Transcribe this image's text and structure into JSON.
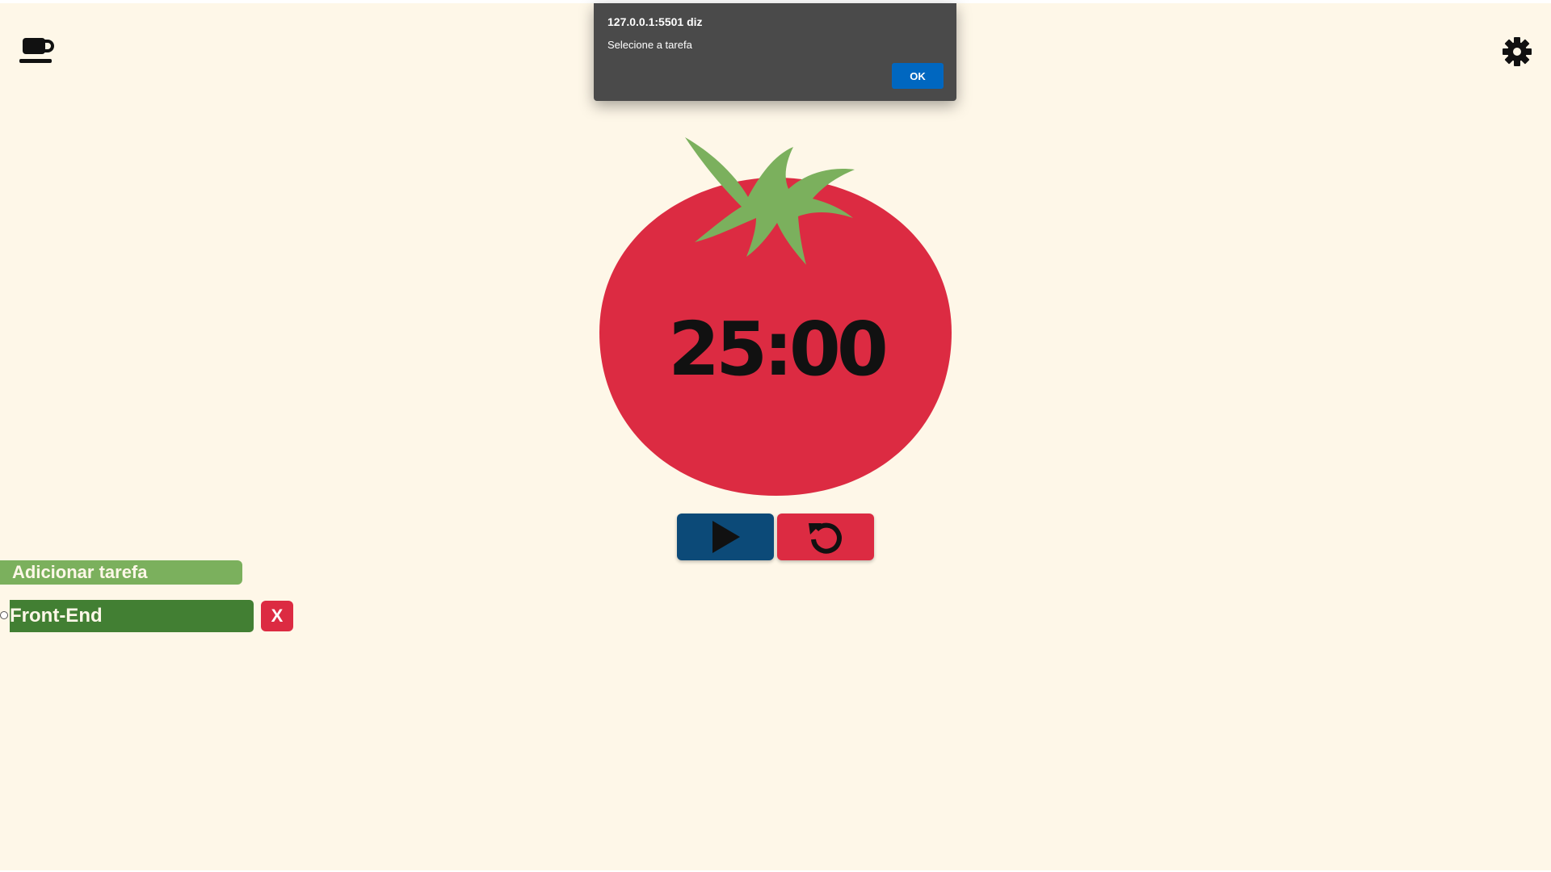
{
  "app": {
    "timer": "25:00"
  },
  "header": {
    "left_icon": "coffee-cup-icon",
    "right_icon": "gear-icon"
  },
  "controls": {
    "play_icon": "play-icon",
    "reset_icon": "reset-icon"
  },
  "tasks": {
    "add_label": "Adicionar tarefa",
    "items": [
      {
        "name": "Front-End",
        "delete_label": "X"
      }
    ]
  },
  "dialog": {
    "title": "127.0.0.1:5501 diz",
    "message": "Selecione a tarefa",
    "ok_label": "OK"
  },
  "colors": {
    "background": "#fef7e8",
    "tomato": "#dc2b42",
    "leaves": "#7bb05d",
    "play_button": "#0c4a78",
    "reset_button": "#dc2b42",
    "add_task": "#7bb05d",
    "task_item": "#427f33",
    "dialog_bg": "#4a4a4a",
    "dialog_ok": "#0067c0"
  }
}
